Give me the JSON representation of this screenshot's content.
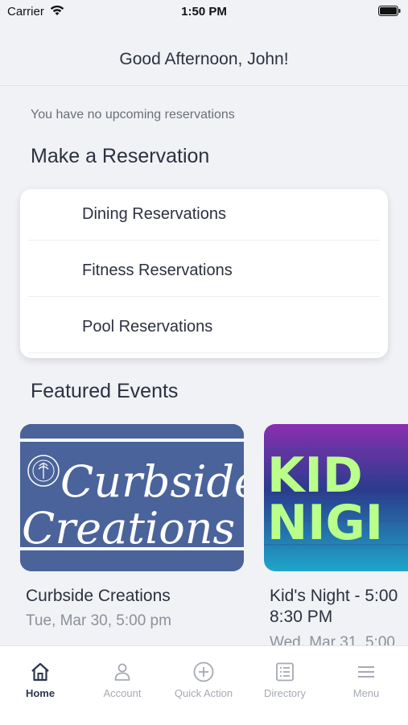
{
  "status_bar": {
    "carrier": "Carrier",
    "time": "1:50 PM"
  },
  "header": {
    "greeting": "Good Afternoon, John!"
  },
  "reservations_notice": "You have no upcoming reservations",
  "make_reservation": {
    "title": "Make a Reservation",
    "items": [
      {
        "label": "Dining Reservations"
      },
      {
        "label": "Fitness Reservations"
      },
      {
        "label": "Pool Reservations"
      }
    ]
  },
  "featured_events": {
    "title": "Featured Events",
    "events": [
      {
        "title": "Curbside Creations",
        "date": "Tue, Mar 30, 5:00 pm",
        "image_text": [
          "Curbside",
          "Creations"
        ],
        "image_bg": "#4a639a"
      },
      {
        "title_line1": "Kid's Night - 5:00",
        "title_line2": "8:30 PM",
        "date": "Wed, Mar 31, 5:00",
        "image_text": [
          "KID",
          "NIGI"
        ],
        "image_bg": "#2a3c8c"
      }
    ]
  },
  "tabbar": {
    "tabs": [
      {
        "label": "Home",
        "icon": "home-icon",
        "active": true
      },
      {
        "label": "Account",
        "icon": "account-icon",
        "active": false
      },
      {
        "label": "Quick Action",
        "icon": "plus-circle-icon",
        "active": false
      },
      {
        "label": "Directory",
        "icon": "directory-icon",
        "active": false
      },
      {
        "label": "Menu",
        "icon": "menu-icon",
        "active": false
      }
    ]
  },
  "colors": {
    "background": "#f1f2f6",
    "text_primary": "#2c3140",
    "text_muted": "#8c909a",
    "tab_active": "#2a3650",
    "tab_inactive": "#a6aab3"
  }
}
